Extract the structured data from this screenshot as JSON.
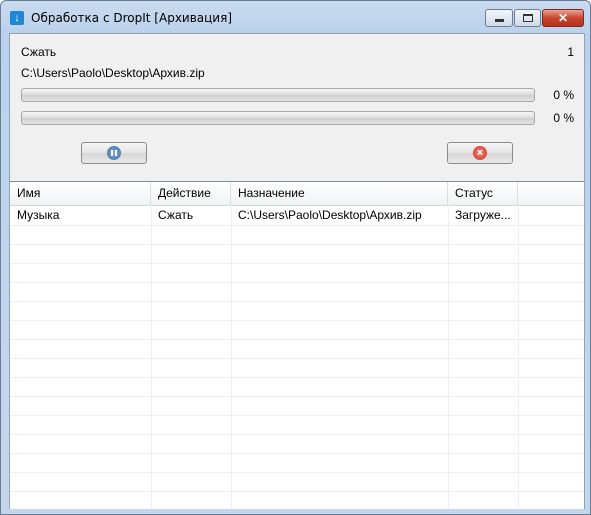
{
  "window": {
    "title": "Обработка с DropIt [Архивация]",
    "app_icon": "dropit-arrow-icon",
    "controls": {
      "minimize": "minimize-icon",
      "maximize": "maximize-icon",
      "close": "✕"
    }
  },
  "status": {
    "action": "Сжать",
    "count": "1",
    "path": "C:\\Users\\Paolo\\Desktop\\Архив.zip",
    "progress1": {
      "percent_label": "0 %",
      "value": 0
    },
    "progress2": {
      "percent_label": "0 %",
      "value": 0
    }
  },
  "buttons": {
    "pause": "pause-icon",
    "stop": "stop-icon"
  },
  "table": {
    "columns": [
      "Имя",
      "Действие",
      "Назначение",
      "Статус"
    ],
    "rows": [
      [
        "Музыка",
        "Сжать",
        "C:\\Users\\Paolo\\Desktop\\Архив.zip",
        "Загруже..."
      ]
    ]
  },
  "colors": {
    "progress_fill": "#37c23f",
    "close_button": "#c8462e",
    "title_gradient": "#bcd2ec"
  }
}
